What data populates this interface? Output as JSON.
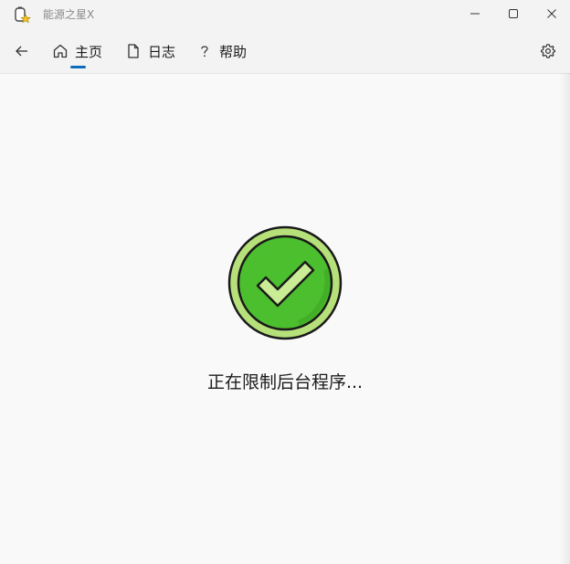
{
  "window": {
    "title": "能源之星X",
    "controls": [
      "minimize-icon",
      "maximize-icon",
      "close-icon"
    ]
  },
  "nav": {
    "back_icon": "back-arrow-icon",
    "items": [
      {
        "label": "主页",
        "icon": "home-icon",
        "selected": true
      },
      {
        "label": "日志",
        "icon": "document-icon",
        "selected": false
      },
      {
        "label": "帮助",
        "icon": "question-icon",
        "selected": false
      }
    ],
    "settings_icon": "gear-icon"
  },
  "main": {
    "status_text": "正在限制后台程序...",
    "status_icon": "check-circle-icon"
  },
  "colors": {
    "accent": "#0f6cbd",
    "check_green": "#4cbf2f",
    "check_light": "#b6e07a"
  }
}
